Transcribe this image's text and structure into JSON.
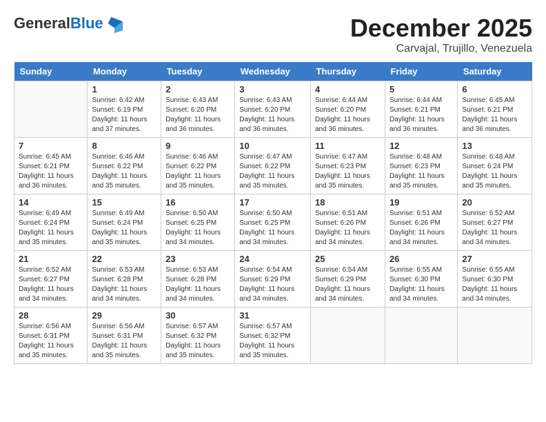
{
  "header": {
    "logo_line1": "General",
    "logo_line2": "Blue",
    "month": "December 2025",
    "location": "Carvajal, Trujillo, Venezuela"
  },
  "days_of_week": [
    "Sunday",
    "Monday",
    "Tuesday",
    "Wednesday",
    "Thursday",
    "Friday",
    "Saturday"
  ],
  "weeks": [
    [
      {
        "day": "",
        "sunrise": "",
        "sunset": "",
        "daylight": ""
      },
      {
        "day": "1",
        "sunrise": "Sunrise: 6:42 AM",
        "sunset": "Sunset: 6:19 PM",
        "daylight": "Daylight: 11 hours and 37 minutes."
      },
      {
        "day": "2",
        "sunrise": "Sunrise: 6:43 AM",
        "sunset": "Sunset: 6:20 PM",
        "daylight": "Daylight: 11 hours and 36 minutes."
      },
      {
        "day": "3",
        "sunrise": "Sunrise: 6:43 AM",
        "sunset": "Sunset: 6:20 PM",
        "daylight": "Daylight: 11 hours and 36 minutes."
      },
      {
        "day": "4",
        "sunrise": "Sunrise: 6:44 AM",
        "sunset": "Sunset: 6:20 PM",
        "daylight": "Daylight: 11 hours and 36 minutes."
      },
      {
        "day": "5",
        "sunrise": "Sunrise: 6:44 AM",
        "sunset": "Sunset: 6:21 PM",
        "daylight": "Daylight: 11 hours and 36 minutes."
      },
      {
        "day": "6",
        "sunrise": "Sunrise: 6:45 AM",
        "sunset": "Sunset: 6:21 PM",
        "daylight": "Daylight: 11 hours and 36 minutes."
      }
    ],
    [
      {
        "day": "7",
        "sunrise": "Sunrise: 6:45 AM",
        "sunset": "Sunset: 6:21 PM",
        "daylight": "Daylight: 11 hours and 36 minutes."
      },
      {
        "day": "8",
        "sunrise": "Sunrise: 6:46 AM",
        "sunset": "Sunset: 6:22 PM",
        "daylight": "Daylight: 11 hours and 35 minutes."
      },
      {
        "day": "9",
        "sunrise": "Sunrise: 6:46 AM",
        "sunset": "Sunset: 6:22 PM",
        "daylight": "Daylight: 11 hours and 35 minutes."
      },
      {
        "day": "10",
        "sunrise": "Sunrise: 6:47 AM",
        "sunset": "Sunset: 6:22 PM",
        "daylight": "Daylight: 11 hours and 35 minutes."
      },
      {
        "day": "11",
        "sunrise": "Sunrise: 6:47 AM",
        "sunset": "Sunset: 6:23 PM",
        "daylight": "Daylight: 11 hours and 35 minutes."
      },
      {
        "day": "12",
        "sunrise": "Sunrise: 6:48 AM",
        "sunset": "Sunset: 6:23 PM",
        "daylight": "Daylight: 11 hours and 35 minutes."
      },
      {
        "day": "13",
        "sunrise": "Sunrise: 6:48 AM",
        "sunset": "Sunset: 6:24 PM",
        "daylight": "Daylight: 11 hours and 35 minutes."
      }
    ],
    [
      {
        "day": "14",
        "sunrise": "Sunrise: 6:49 AM",
        "sunset": "Sunset: 6:24 PM",
        "daylight": "Daylight: 11 hours and 35 minutes."
      },
      {
        "day": "15",
        "sunrise": "Sunrise: 6:49 AM",
        "sunset": "Sunset: 6:24 PM",
        "daylight": "Daylight: 11 hours and 35 minutes."
      },
      {
        "day": "16",
        "sunrise": "Sunrise: 6:50 AM",
        "sunset": "Sunset: 6:25 PM",
        "daylight": "Daylight: 11 hours and 34 minutes."
      },
      {
        "day": "17",
        "sunrise": "Sunrise: 6:50 AM",
        "sunset": "Sunset: 6:25 PM",
        "daylight": "Daylight: 11 hours and 34 minutes."
      },
      {
        "day": "18",
        "sunrise": "Sunrise: 6:51 AM",
        "sunset": "Sunset: 6:26 PM",
        "daylight": "Daylight: 11 hours and 34 minutes."
      },
      {
        "day": "19",
        "sunrise": "Sunrise: 6:51 AM",
        "sunset": "Sunset: 6:26 PM",
        "daylight": "Daylight: 11 hours and 34 minutes."
      },
      {
        "day": "20",
        "sunrise": "Sunrise: 6:52 AM",
        "sunset": "Sunset: 6:27 PM",
        "daylight": "Daylight: 11 hours and 34 minutes."
      }
    ],
    [
      {
        "day": "21",
        "sunrise": "Sunrise: 6:52 AM",
        "sunset": "Sunset: 6:27 PM",
        "daylight": "Daylight: 11 hours and 34 minutes."
      },
      {
        "day": "22",
        "sunrise": "Sunrise: 6:53 AM",
        "sunset": "Sunset: 6:28 PM",
        "daylight": "Daylight: 11 hours and 34 minutes."
      },
      {
        "day": "23",
        "sunrise": "Sunrise: 6:53 AM",
        "sunset": "Sunset: 6:28 PM",
        "daylight": "Daylight: 11 hours and 34 minutes."
      },
      {
        "day": "24",
        "sunrise": "Sunrise: 6:54 AM",
        "sunset": "Sunset: 6:29 PM",
        "daylight": "Daylight: 11 hours and 34 minutes."
      },
      {
        "day": "25",
        "sunrise": "Sunrise: 6:54 AM",
        "sunset": "Sunset: 6:29 PM",
        "daylight": "Daylight: 11 hours and 34 minutes."
      },
      {
        "day": "26",
        "sunrise": "Sunrise: 6:55 AM",
        "sunset": "Sunset: 6:30 PM",
        "daylight": "Daylight: 11 hours and 34 minutes."
      },
      {
        "day": "27",
        "sunrise": "Sunrise: 6:55 AM",
        "sunset": "Sunset: 6:30 PM",
        "daylight": "Daylight: 11 hours and 34 minutes."
      }
    ],
    [
      {
        "day": "28",
        "sunrise": "Sunrise: 6:56 AM",
        "sunset": "Sunset: 6:31 PM",
        "daylight": "Daylight: 11 hours and 35 minutes."
      },
      {
        "day": "29",
        "sunrise": "Sunrise: 6:56 AM",
        "sunset": "Sunset: 6:31 PM",
        "daylight": "Daylight: 11 hours and 35 minutes."
      },
      {
        "day": "30",
        "sunrise": "Sunrise: 6:57 AM",
        "sunset": "Sunset: 6:32 PM",
        "daylight": "Daylight: 11 hours and 35 minutes."
      },
      {
        "day": "31",
        "sunrise": "Sunrise: 6:57 AM",
        "sunset": "Sunset: 6:32 PM",
        "daylight": "Daylight: 11 hours and 35 minutes."
      },
      {
        "day": "",
        "sunrise": "",
        "sunset": "",
        "daylight": ""
      },
      {
        "day": "",
        "sunrise": "",
        "sunset": "",
        "daylight": ""
      },
      {
        "day": "",
        "sunrise": "",
        "sunset": "",
        "daylight": ""
      }
    ]
  ]
}
